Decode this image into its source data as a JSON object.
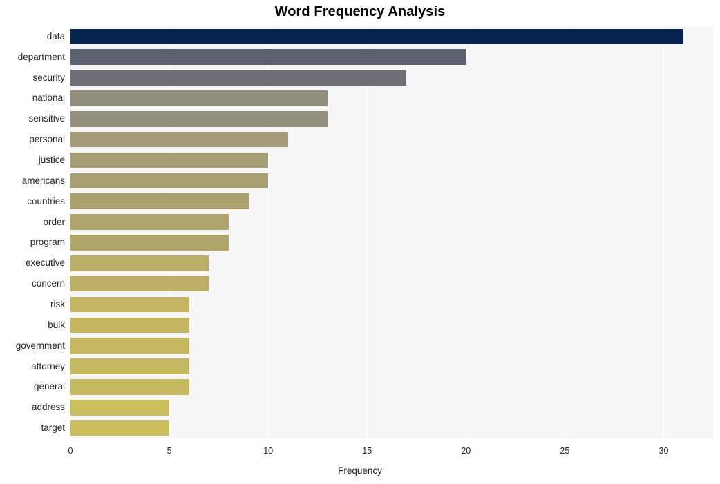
{
  "chart_data": {
    "type": "bar",
    "orientation": "horizontal",
    "title": "Word Frequency Analysis",
    "xlabel": "Frequency",
    "ylabel": "",
    "categories": [
      "data",
      "department",
      "security",
      "national",
      "sensitive",
      "personal",
      "justice",
      "americans",
      "countries",
      "order",
      "program",
      "executive",
      "concern",
      "risk",
      "bulk",
      "government",
      "attorney",
      "general",
      "address",
      "target"
    ],
    "values": [
      31,
      20,
      17,
      13,
      13,
      11,
      10,
      10,
      9,
      8,
      8,
      7,
      7,
      6,
      6,
      6,
      6,
      6,
      5,
      5
    ],
    "xlim": [
      0,
      32.5
    ],
    "xticks": [
      0,
      5,
      10,
      15,
      20,
      25,
      30
    ],
    "xtick_labels": [
      "0",
      "5",
      "10",
      "15",
      "20",
      "25",
      "30"
    ],
    "grid": "vertical",
    "legend": "none",
    "bar_colors": [
      "#052450",
      "#5c6270",
      "#6f7075",
      "#918d7c",
      "#938f7d",
      "#a39b75",
      "#a69e74",
      "#a89f73",
      "#aaa16f",
      "#afa56c",
      "#b1a76b",
      "#bbae66",
      "#bcaf65",
      "#c3b562",
      "#c4b661",
      "#c5b760",
      "#c6b860",
      "#c7b95f",
      "#cdbf5e",
      "#cdbf5e"
    ],
    "plot_background": "#f6f6f6",
    "figure_background": "#ffffff",
    "title_color": "#000000",
    "tick_color": "#262626",
    "gridline_color": "#ffffff"
  }
}
